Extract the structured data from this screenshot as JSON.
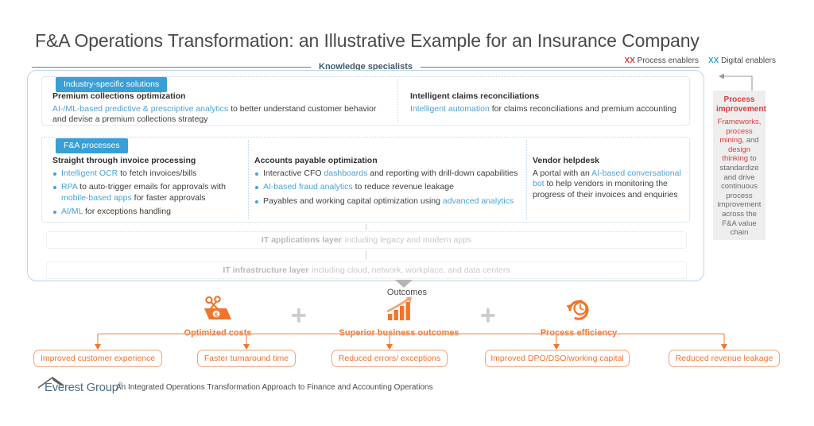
{
  "page_title": "F&A Operations Transformation: an Illustrative Example for an Insurance Company",
  "legend": {
    "process": {
      "xx": "XX",
      "label": "Process enablers",
      "color": "#e03a3e"
    },
    "digital": {
      "xx": "XX",
      "label": "Digital enablers",
      "color": "#3a9fd6"
    }
  },
  "knowledge_specialists_label": "Knowledge specialists",
  "top_panel": {
    "tag": "Industry-specific solutions",
    "left": {
      "heading": "Premium collections optimization",
      "highlight": "AI-/ML-based predictive & prescriptive analytics",
      "rest": " to better understand customer behavior and devise a premium collections strategy"
    },
    "right": {
      "heading": "Intelligent claims reconciliations",
      "highlight": "Intelligent automation",
      "rest": " for claims reconciliations and premium accounting"
    }
  },
  "mid_panel": {
    "tag": "F&A processes",
    "col1": {
      "heading": "Straight through invoice processing",
      "bullets": [
        {
          "pre": "",
          "hl": "Intelligent OCR",
          "post": " to fetch invoices/bills"
        },
        {
          "pre": "",
          "hl": "RPA",
          "post": " to auto-trigger emails for approvals with ",
          "hl2": "mobile-based apps",
          "post2": " for faster approvals"
        },
        {
          "pre": "",
          "hl": "AI/ML",
          "post": " for exceptions handling"
        }
      ]
    },
    "col2": {
      "heading": "Accounts payable optimization",
      "bullets": [
        {
          "pre": "Interactive CFO ",
          "hl": "dashboards",
          "post": " and reporting with drill-down capabilities"
        },
        {
          "pre": "",
          "hl": "AI-based fraud analytics",
          "post": " to reduce revenue leakage"
        },
        {
          "pre": "Payables and working capital optimization using ",
          "hl": "advanced analytics",
          "post": ""
        }
      ]
    },
    "col3": {
      "heading": "Vendor helpdesk",
      "pre": "A portal with an ",
      "hl": "AI-based conversational bot",
      "post": " to help vendors in monitoring the progress of their invoices and enquiries"
    }
  },
  "it_layers": {
    "applications": {
      "bold": "IT applications layer",
      "rest": "including legacy and modern apps"
    },
    "infrastructure": {
      "bold": "IT infrastructure layer",
      "rest": "including cloud, network, workplace, and data centers"
    }
  },
  "process_improvement": {
    "title": "Process improvement",
    "seg1": "Frameworks, process mining,",
    "seg2": " and ",
    "seg3": "design thinking",
    "seg4": " to standardize and drive continuous process improvement across the F&A value chain"
  },
  "outcomes": {
    "label": "Outcomes",
    "plus": "+",
    "items": [
      {
        "icon": "cost-scissors-icon",
        "caption": "Optimized costs"
      },
      {
        "icon": "bar-chart-growth-icon",
        "caption": "Superior business outcomes"
      },
      {
        "icon": "stopwatch-icon",
        "caption": "Process efficiency"
      }
    ],
    "chips": [
      "Improved customer experience",
      "Faster turnaround time",
      "Reduced errors/ exceptions",
      "Improved DPO/DSO/working capital",
      "Reduced revenue leakage"
    ]
  },
  "footer": {
    "brand": "Everest Group",
    "registered": "®",
    "text": "An Integrated Operations Transformation Approach to Finance and Accounting Operations"
  },
  "colors": {
    "accent_blue": "#3a9fd6",
    "accent_orange": "#f2742a",
    "accent_red": "#e03a3e",
    "panel_border": "#bcd6e4"
  }
}
